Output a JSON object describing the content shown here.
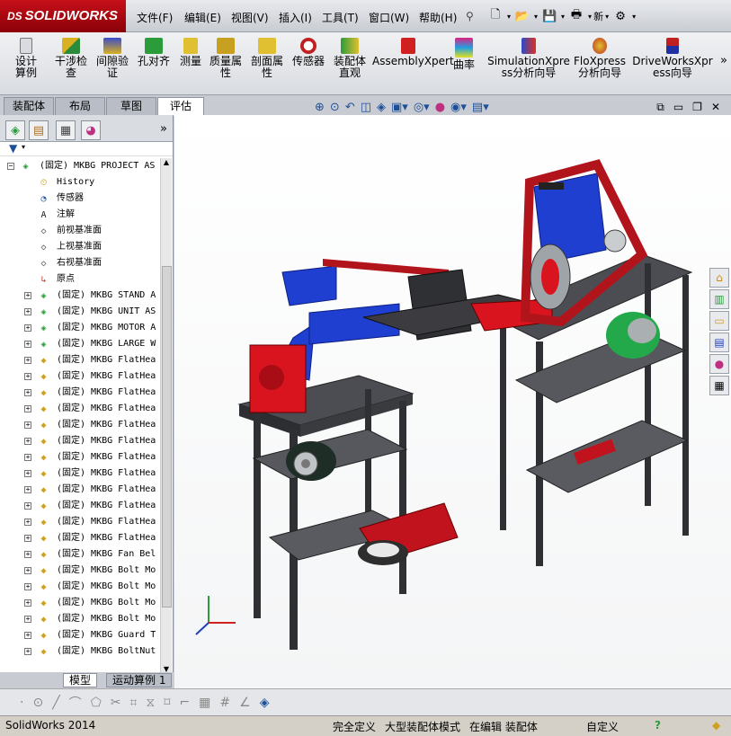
{
  "app": {
    "logo": "SOLIDWORKS",
    "logo_mark": "DS"
  },
  "menu": [
    "文件(F)",
    "编辑(E)",
    "视图(V)",
    "插入(I)",
    "工具(T)",
    "窗口(W)",
    "帮助(H)"
  ],
  "quick_access": {
    "new_icon": "new-doc-icon",
    "open_icon": "open-folder-icon",
    "save_icon": "save-icon",
    "print_icon": "print-icon",
    "rebuild_label": "新"
  },
  "command_manager": [
    {
      "label": "设计算例",
      "icon": "design-study-icon"
    },
    {
      "label": "干涉检查",
      "icon": "interference-icon"
    },
    {
      "label": "间隙验证",
      "icon": "clearance-icon"
    },
    {
      "label": "孔对齐",
      "icon": "hole-align-icon"
    },
    {
      "label": "测量",
      "icon": "measure-icon"
    },
    {
      "label": "质量属性",
      "icon": "mass-props-icon"
    },
    {
      "label": "剖面属性",
      "icon": "section-props-icon"
    },
    {
      "label": "传感器",
      "icon": "sensor-icon"
    },
    {
      "label": "装配体直观",
      "icon": "assembly-visualize-icon"
    },
    {
      "label": "AssemblyXpert",
      "icon": "assemblyxpert-icon"
    },
    {
      "label": "曲率",
      "icon": "curvature-icon"
    },
    {
      "label": "SimulationXpress分析向导",
      "icon": "simulation-icon"
    },
    {
      "label": "FloXpress分析向导",
      "icon": "floxpress-icon"
    },
    {
      "label": "DriveWorksXpress向导",
      "icon": "driveworks-icon"
    }
  ],
  "cm_tabs": [
    "装配体",
    "布局",
    "草图",
    "评估"
  ],
  "active_cm_tab": "评估",
  "tree": {
    "root": "(固定) MKBG PROJECT AS",
    "items": [
      {
        "label": "History",
        "icon": "history-icon",
        "exp": ""
      },
      {
        "label": "传感器",
        "icon": "sensor-icon",
        "exp": ""
      },
      {
        "label": "注解",
        "icon": "annotation-icon",
        "exp": ""
      },
      {
        "label": "前视基准面",
        "icon": "plane-icon",
        "exp": ""
      },
      {
        "label": "上视基准面",
        "icon": "plane-icon",
        "exp": ""
      },
      {
        "label": "右视基准面",
        "icon": "plane-icon",
        "exp": ""
      },
      {
        "label": "原点",
        "icon": "origin-icon",
        "exp": ""
      },
      {
        "label": "(固定) MKBG STAND A",
        "icon": "subassembly-icon",
        "exp": "+"
      },
      {
        "label": "(固定) MKBG UNIT AS",
        "icon": "subassembly-icon",
        "exp": "+"
      },
      {
        "label": "(固定) MKBG MOTOR A",
        "icon": "subassembly-icon",
        "exp": "+"
      },
      {
        "label": "(固定) MKBG LARGE W",
        "icon": "subassembly-icon",
        "exp": "+"
      },
      {
        "label": "(固定) MKBG FlatHea",
        "icon": "part-icon",
        "exp": "+"
      },
      {
        "label": "(固定) MKBG FlatHea",
        "icon": "part-icon",
        "exp": "+"
      },
      {
        "label": "(固定) MKBG FlatHea",
        "icon": "part-icon",
        "exp": "+"
      },
      {
        "label": "(固定) MKBG FlatHea",
        "icon": "part-icon",
        "exp": "+"
      },
      {
        "label": "(固定) MKBG FlatHea",
        "icon": "part-icon",
        "exp": "+"
      },
      {
        "label": "(固定) MKBG FlatHea",
        "icon": "part-icon",
        "exp": "+"
      },
      {
        "label": "(固定) MKBG FlatHea",
        "icon": "part-icon",
        "exp": "+"
      },
      {
        "label": "(固定) MKBG FlatHea",
        "icon": "part-icon",
        "exp": "+"
      },
      {
        "label": "(固定) MKBG FlatHea",
        "icon": "part-icon",
        "exp": "+"
      },
      {
        "label": "(固定) MKBG FlatHea",
        "icon": "part-icon",
        "exp": "+"
      },
      {
        "label": "(固定) MKBG FlatHea",
        "icon": "part-icon",
        "exp": "+"
      },
      {
        "label": "(固定) MKBG FlatHea",
        "icon": "part-icon",
        "exp": "+"
      },
      {
        "label": "(固定) MKBG Fan Bel",
        "icon": "part-icon",
        "exp": "+"
      },
      {
        "label": "(固定) MKBG Bolt Mo",
        "icon": "part-icon",
        "exp": "+"
      },
      {
        "label": "(固定) MKBG Bolt Mo",
        "icon": "part-icon",
        "exp": "+"
      },
      {
        "label": "(固定) MKBG Bolt Mo",
        "icon": "part-icon",
        "exp": "+"
      },
      {
        "label": "(固定) MKBG Bolt Mo",
        "icon": "part-icon",
        "exp": "+"
      },
      {
        "label": "(固定) MKBG Guard T",
        "icon": "part-icon",
        "exp": "+"
      },
      {
        "label": "(固定) MKBG BoltNut",
        "icon": "part-icon",
        "exp": "+"
      }
    ]
  },
  "bottom_tabs": [
    "模型",
    "运动算例 1"
  ],
  "status": {
    "app_version": "SolidWorks 2014",
    "defined": "完全定义",
    "mode": "大型装配体模式",
    "editing": "在编辑 装配体",
    "units": "自定义",
    "help_icon": "help-icon"
  },
  "colors": {
    "brand_red": "#b0101a",
    "part_red": "#d9141e",
    "part_blue": "#1f3fd0",
    "frame": "#2f3033",
    "plate": "#505156",
    "motor_green": "#23a84a"
  }
}
